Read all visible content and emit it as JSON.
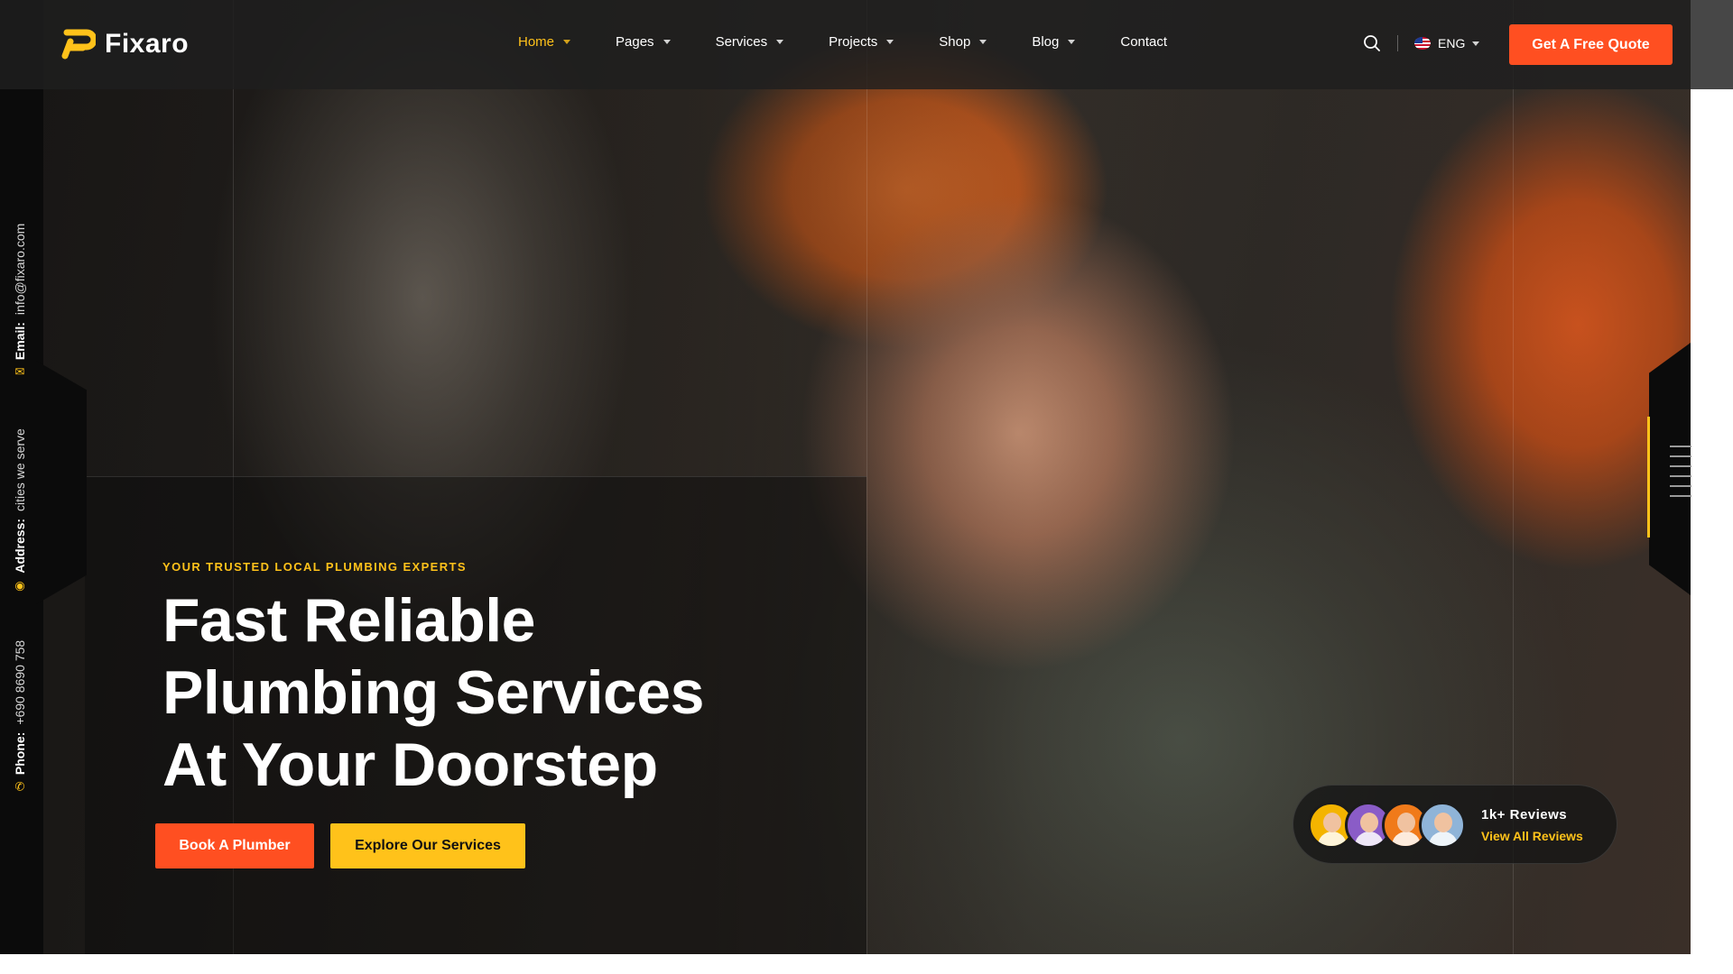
{
  "brand": {
    "name": "Fixaro",
    "logo_color": "#ffc21a"
  },
  "nav": {
    "items": [
      {
        "label": "Home",
        "active": true,
        "has_dropdown": true
      },
      {
        "label": "Pages",
        "active": false,
        "has_dropdown": true
      },
      {
        "label": "Services",
        "active": false,
        "has_dropdown": true
      },
      {
        "label": "Projects",
        "active": false,
        "has_dropdown": true
      },
      {
        "label": "Shop",
        "active": false,
        "has_dropdown": true
      },
      {
        "label": "Blog",
        "active": false,
        "has_dropdown": true
      },
      {
        "label": "Contact",
        "active": false,
        "has_dropdown": false
      }
    ],
    "search_icon": "search-icon",
    "language": "ENG",
    "cta_label": "Get A Free Quote"
  },
  "sidebar": {
    "email_label": "Email:",
    "email_value": "info@fixaro.com",
    "address_label": "Address:",
    "address_value": "cities we serve",
    "phone_label": "Phone:",
    "phone_value": "+690 8690 758"
  },
  "hero": {
    "eyebrow": "YOUR TRUSTED LOCAL PLUMBING EXPERTS",
    "headline_lines": [
      "Fast Reliable",
      "Plumbing Services",
      "At Your Doorstep"
    ],
    "primary_button": "Book A Plumber",
    "secondary_button": "Explore Our Services"
  },
  "reviews": {
    "title": "1k+ Reviews",
    "link": "View All Reviews",
    "avatar_colors": [
      "#f4b400",
      "#8a5cc7",
      "#f07a1a",
      "#8fb4d8"
    ]
  },
  "colors": {
    "accent_orange": "#ff4f21",
    "accent_yellow": "#ffc21a",
    "nav_bg": "#1e1e1e"
  }
}
